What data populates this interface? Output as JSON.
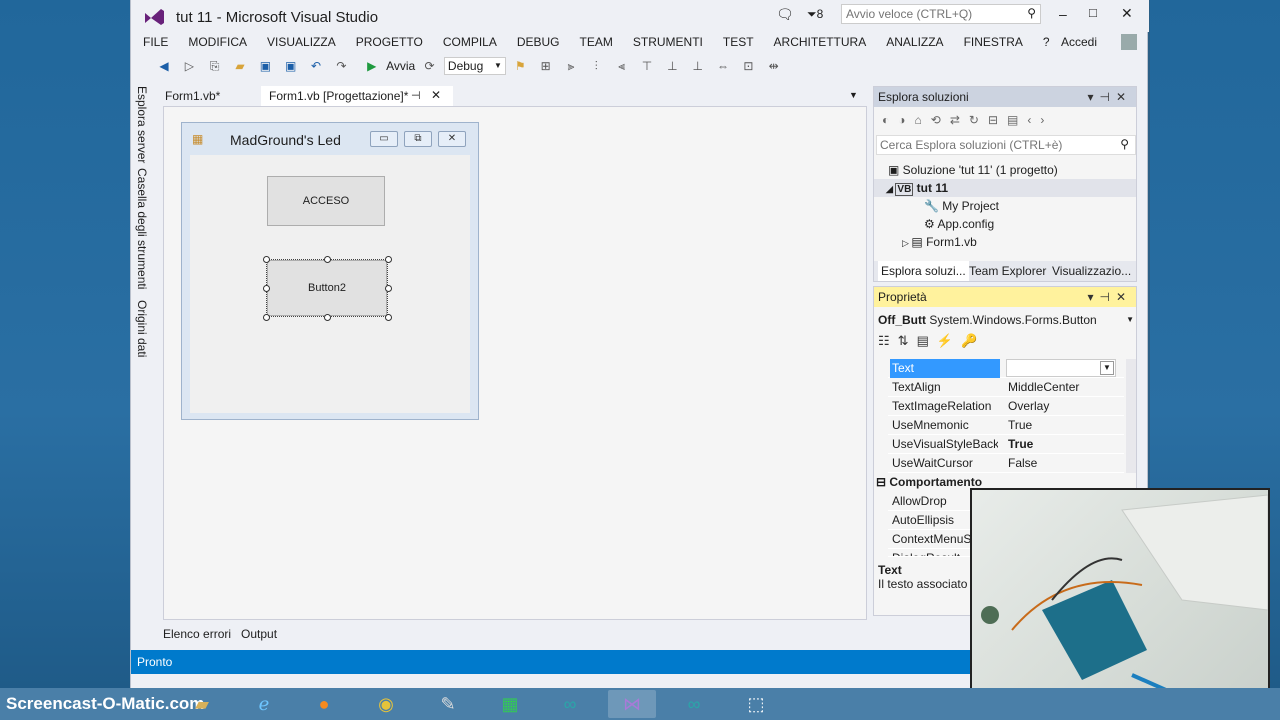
{
  "window": {
    "title": "tut 11 - Microsoft Visual Studio",
    "notif_count": "8",
    "quicklaunch_placeholder": "Avvio veloce (CTRL+Q)",
    "signin": "Accedi"
  },
  "menu": [
    "FILE",
    "MODIFICA",
    "VISUALIZZA",
    "PROGETTO",
    "COMPILA",
    "DEBUG",
    "TEAM",
    "STRUMENTI",
    "TEST",
    "ARCHITETTURA",
    "ANALIZZA",
    "FINESTRA",
    "?"
  ],
  "toolbar": {
    "start_label": "Avvia",
    "config": "Debug"
  },
  "left_tabs": [
    "Esplora server",
    "Casella degli strumenti",
    "Origini dati"
  ],
  "doc_tabs": [
    "Form1.vb*",
    "Form1.vb [Progettazione]*"
  ],
  "form": {
    "title": "MadGround's Led",
    "button1": "ACCESO",
    "button2": "Button2"
  },
  "bottom_tabs": [
    "Elenco errori",
    "Output"
  ],
  "status": "Pronto",
  "solution": {
    "header": "Esplora soluzioni",
    "search_placeholder": "Cerca Esplora soluzioni (CTRL+è)",
    "items": [
      "Soluzione 'tut 11'  (1 progetto)",
      "tut 11",
      "My Project",
      "App.config",
      "Form1.vb"
    ],
    "tabs": [
      "Esplora soluzi...",
      "Team Explorer",
      "Visualizzazio..."
    ]
  },
  "properties": {
    "header": "Proprietà",
    "object": "Off_Butt",
    "object_type": "System.Windows.Forms.Button",
    "rows": [
      {
        "name": "Text",
        "value": ""
      },
      {
        "name": "TextAlign",
        "value": "MiddleCenter"
      },
      {
        "name": "TextImageRelation",
        "value": "Overlay"
      },
      {
        "name": "UseMnemonic",
        "value": "True"
      },
      {
        "name": "UseVisualStyleBackC",
        "value": "True"
      },
      {
        "name": "UseWaitCursor",
        "value": "False"
      }
    ],
    "category": "Comportamento",
    "behavior_rows": [
      "AllowDrop",
      "AutoEllipsis",
      "ContextMenuSt",
      "DialogResult"
    ],
    "desc_title": "Text",
    "desc_text": "Il testo associato a"
  },
  "watermark": "Screencast-O-Matic.com"
}
